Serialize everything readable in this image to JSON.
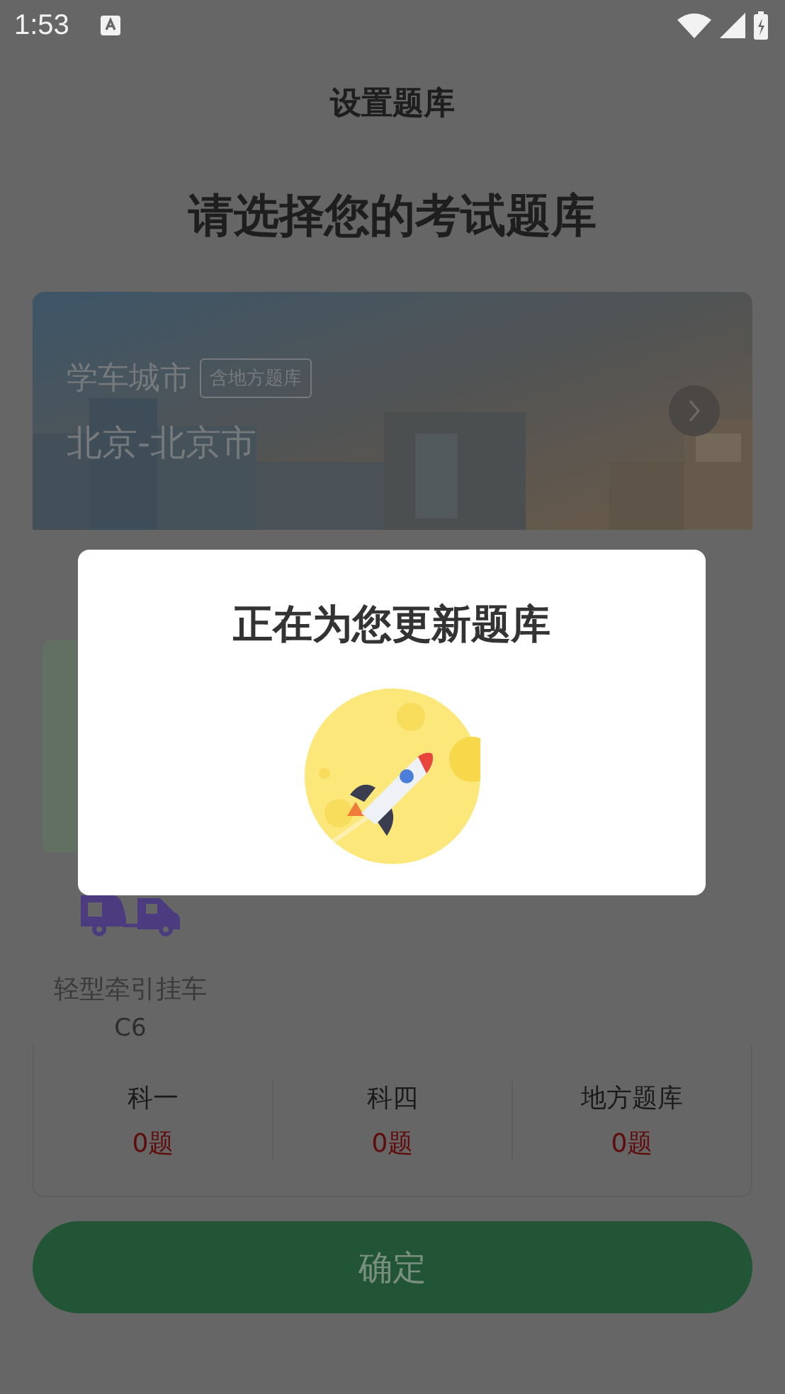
{
  "status_bar": {
    "time": "1:53"
  },
  "header": {
    "title": "设置题库"
  },
  "heading": "请选择您的考试题库",
  "city_card": {
    "label": "学车城市",
    "tag": "含地方题库",
    "city": "北京-北京市"
  },
  "vehicle": {
    "name": "轻型牵引挂车",
    "code": "C6"
  },
  "stats": [
    {
      "label": "科一",
      "value": "0题"
    },
    {
      "label": "科四",
      "value": "0题"
    },
    {
      "label": "地方题库",
      "value": "0题"
    }
  ],
  "confirm_button": {
    "label": "确定"
  },
  "dialog": {
    "title": "正在为您更新题库"
  }
}
